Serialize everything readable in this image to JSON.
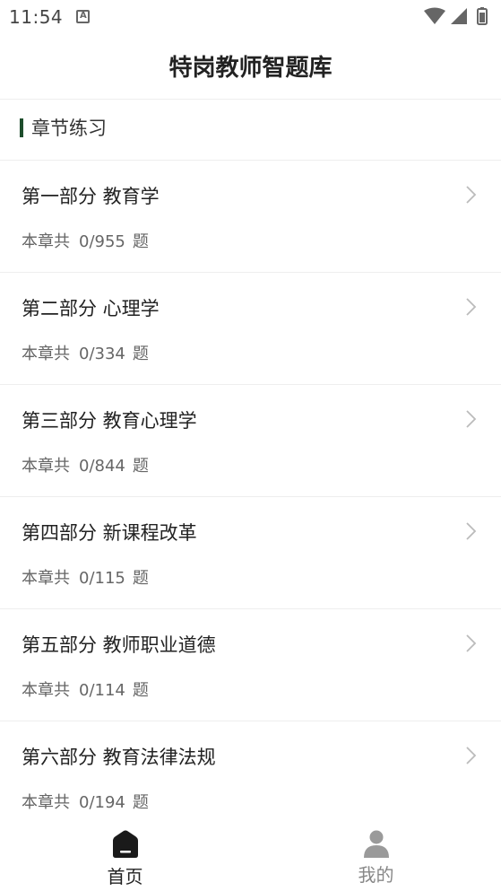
{
  "status_bar": {
    "time": "11:54",
    "notif_letter": "A"
  },
  "header": {
    "title": "特岗教师智题库"
  },
  "section": {
    "title": "章节练习"
  },
  "chapters": [
    {
      "title": "第一部分 教育学",
      "prefix": "本章共",
      "count": "0/955",
      "suffix": "题"
    },
    {
      "title": "第二部分 心理学",
      "prefix": "本章共",
      "count": "0/334",
      "suffix": "题"
    },
    {
      "title": "第三部分 教育心理学",
      "prefix": "本章共",
      "count": "0/844",
      "suffix": "题"
    },
    {
      "title": "第四部分 新课程改革",
      "prefix": "本章共",
      "count": "0/115",
      "suffix": "题"
    },
    {
      "title": "第五部分 教师职业道德",
      "prefix": "本章共",
      "count": "0/114",
      "suffix": "题"
    },
    {
      "title": "第六部分 教育法律法规",
      "prefix": "本章共",
      "count": "0/194",
      "suffix": "题"
    }
  ],
  "bottom_nav": {
    "home": {
      "label": "首页",
      "icon": "home-icon",
      "active": true
    },
    "mine": {
      "label": "我的",
      "icon": "person-icon",
      "active": false
    }
  },
  "colors": {
    "accent": "#1d4d2c",
    "text": "#222222",
    "muted": "#666666",
    "inactive": "#888888"
  }
}
